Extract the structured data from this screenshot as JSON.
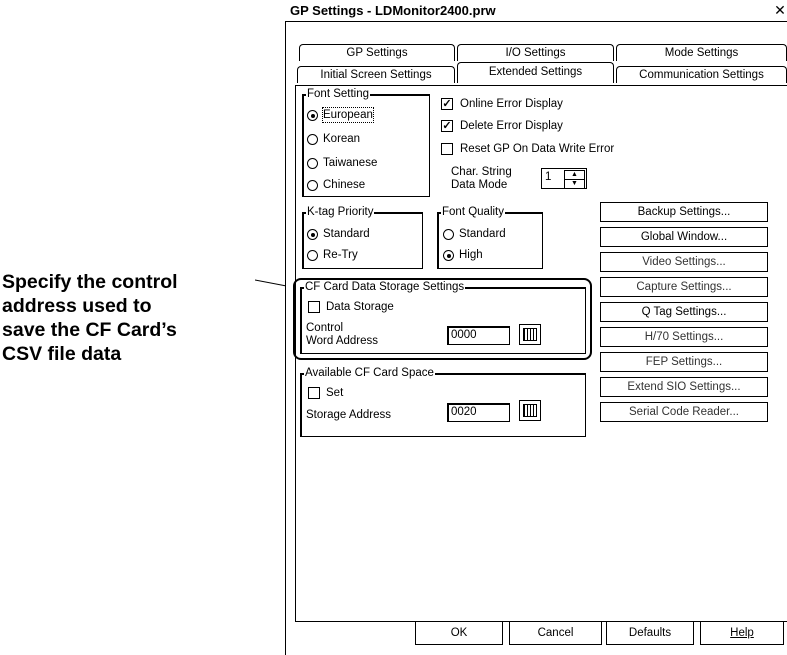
{
  "callout": {
    "line1": "Specify the control",
    "line2": "address used to",
    "line3": "save the CF Card’s",
    "line4": "CSV file data"
  },
  "window": {
    "title": "GP Settings - LDMonitor2400.prw",
    "close": "✕"
  },
  "tabs_top": [
    "GP Settings",
    "I/O Settings",
    "Mode Settings"
  ],
  "tabs_bottom": [
    "Initial Screen Settings",
    "Extended Settings",
    "Communication Settings"
  ],
  "font_setting": {
    "legend": "Font Setting",
    "options": [
      "European",
      "Korean",
      "Taiwanese",
      "Chinese"
    ],
    "selected": "European"
  },
  "checks": {
    "online_error": "Online Error Display",
    "delete_error": "Delete Error Display",
    "reset_gp": "Reset GP On Data Write Error"
  },
  "char_string": {
    "label1": "Char. String",
    "label2": "Data Mode",
    "value": "1"
  },
  "ktag": {
    "legend": "K-tag Priority",
    "options": [
      "Standard",
      "Re-Try"
    ],
    "selected": "Standard"
  },
  "font_quality": {
    "legend": "Font Quality",
    "options": [
      "Standard",
      "High"
    ],
    "selected": "High"
  },
  "cf_storage": {
    "legend": "CF Card Data Storage Settings",
    "checkbox": "Data Storage",
    "label1": "Control",
    "label2": "Word Address",
    "value": "0000"
  },
  "cf_space": {
    "legend": "Available CF Card Space",
    "checkbox": "Set",
    "label": "Storage Address",
    "value": "0020"
  },
  "side_buttons": [
    "Backup Settings...",
    "Global Window...",
    "Video Settings...",
    "Capture Settings...",
    "Q Tag Settings...",
    "H/70 Settings...",
    "FEP Settings...",
    "Extend SIO Settings...",
    "Serial Code Reader..."
  ],
  "bottom_buttons": {
    "ok": "OK",
    "cancel": "Cancel",
    "defaults": "Defaults",
    "help": "Help"
  }
}
